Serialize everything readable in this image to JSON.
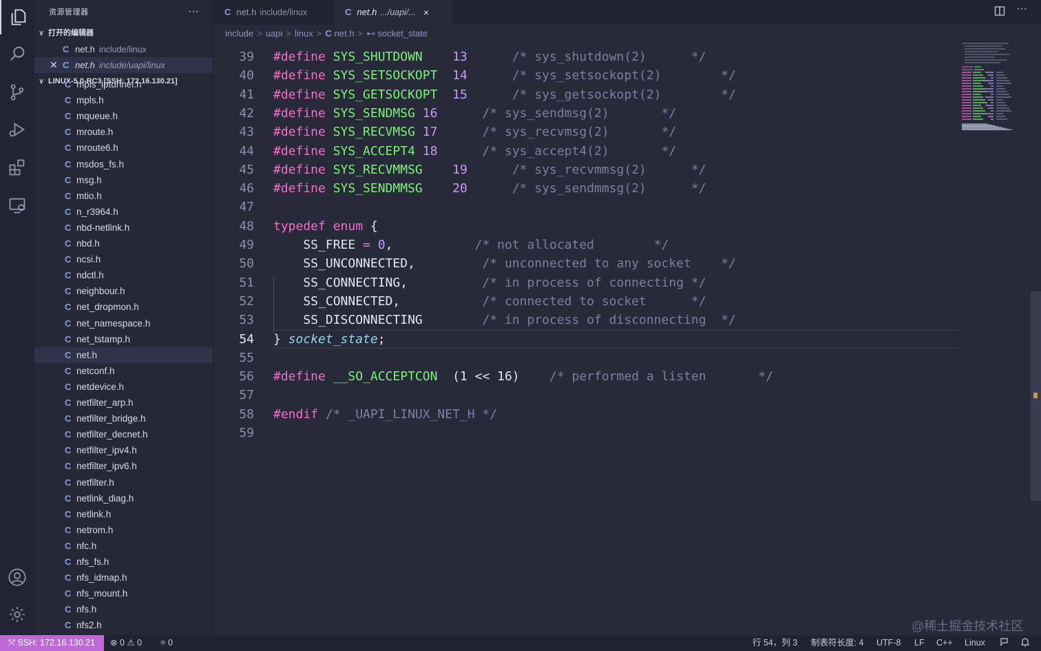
{
  "sidebar": {
    "title": "资源管理器",
    "more": "···",
    "open_editors_header": "打开的编辑器",
    "open_editors": [
      {
        "name": "net.h",
        "path": "include/linux",
        "selected": false
      },
      {
        "name": "net.h",
        "path": "include/uapi/linux",
        "selected": true
      }
    ],
    "workspace_header": "LINUX-5.0-RC3 [SSH: 172.16.130.21]",
    "files": [
      "mpls_iptunnel.h",
      "mpls.h",
      "mqueue.h",
      "mroute.h",
      "mroute6.h",
      "msdos_fs.h",
      "msg.h",
      "mtio.h",
      "n_r3964.h",
      "nbd-netlink.h",
      "nbd.h",
      "ncsi.h",
      "ndctl.h",
      "neighbour.h",
      "net_dropmon.h",
      "net_namespace.h",
      "net_tstamp.h",
      "net.h",
      "netconf.h",
      "netdevice.h",
      "netfilter_arp.h",
      "netfilter_bridge.h",
      "netfilter_decnet.h",
      "netfilter_ipv4.h",
      "netfilter_ipv6.h",
      "netfilter.h",
      "netlink_diag.h",
      "netlink.h",
      "netrom.h",
      "nfc.h",
      "nfs_fs.h",
      "nfs_idmap.h",
      "nfs_mount.h",
      "nfs.h",
      "nfs2.h"
    ],
    "selected_file": "net.h",
    "file_icon_letter": "C"
  },
  "tabs": [
    {
      "icon": "C",
      "name": "net.h",
      "path": "include/linux",
      "active": false
    },
    {
      "icon": "C",
      "name": "net.h",
      "path": ".../uapi/...",
      "active": true,
      "close": "×"
    }
  ],
  "breadcrumb": {
    "parts": [
      "include",
      "uapi",
      "linux",
      "net.h"
    ],
    "symbol": "socket_state",
    "sep": ">",
    "symbol_icon": "⊷"
  },
  "editor": {
    "current_line": 54,
    "lines": [
      {
        "n": "39",
        "tokens": [
          [
            "k",
            "#define "
          ],
          [
            "m",
            "SYS_SHUTDOWN"
          ],
          [
            "t",
            "    "
          ],
          [
            "n",
            "13"
          ],
          [
            "t",
            "      "
          ],
          [
            "cm",
            "/* sys_shutdown(2)      */"
          ]
        ]
      },
      {
        "n": "40",
        "tokens": [
          [
            "k",
            "#define "
          ],
          [
            "m",
            "SYS_SETSOCKOPT"
          ],
          [
            "t",
            "  "
          ],
          [
            "n",
            "14"
          ],
          [
            "t",
            "      "
          ],
          [
            "cm",
            "/* sys_setsockopt(2)        */"
          ]
        ]
      },
      {
        "n": "41",
        "tokens": [
          [
            "k",
            "#define "
          ],
          [
            "m",
            "SYS_GETSOCKOPT"
          ],
          [
            "t",
            "  "
          ],
          [
            "n",
            "15"
          ],
          [
            "t",
            "      "
          ],
          [
            "cm",
            "/* sys_getsockopt(2)        */"
          ]
        ]
      },
      {
        "n": "42",
        "tokens": [
          [
            "k",
            "#define "
          ],
          [
            "m",
            "SYS_SENDMSG"
          ],
          [
            "t",
            " "
          ],
          [
            "n",
            "16"
          ],
          [
            "t",
            "      "
          ],
          [
            "cm",
            "/* sys_sendmsg(2)       */"
          ]
        ]
      },
      {
        "n": "43",
        "tokens": [
          [
            "k",
            "#define "
          ],
          [
            "m",
            "SYS_RECVMSG"
          ],
          [
            "t",
            " "
          ],
          [
            "n",
            "17"
          ],
          [
            "t",
            "      "
          ],
          [
            "cm",
            "/* sys_recvmsg(2)       */"
          ]
        ]
      },
      {
        "n": "44",
        "tokens": [
          [
            "k",
            "#define "
          ],
          [
            "m",
            "SYS_ACCEPT4"
          ],
          [
            "t",
            " "
          ],
          [
            "n",
            "18"
          ],
          [
            "t",
            "      "
          ],
          [
            "cm",
            "/* sys_accept4(2)       */"
          ]
        ]
      },
      {
        "n": "45",
        "tokens": [
          [
            "k",
            "#define "
          ],
          [
            "m",
            "SYS_RECVMMSG"
          ],
          [
            "t",
            "    "
          ],
          [
            "n",
            "19"
          ],
          [
            "t",
            "      "
          ],
          [
            "cm",
            "/* sys_recvmmsg(2)      */"
          ]
        ]
      },
      {
        "n": "46",
        "tokens": [
          [
            "k",
            "#define "
          ],
          [
            "m",
            "SYS_SENDMMSG"
          ],
          [
            "t",
            "    "
          ],
          [
            "n",
            "20"
          ],
          [
            "t",
            "      "
          ],
          [
            "cm",
            "/* sys_sendmmsg(2)      */"
          ]
        ]
      },
      {
        "n": "47",
        "tokens": []
      },
      {
        "n": "48",
        "tokens": [
          [
            "k",
            "typedef "
          ],
          [
            "k",
            "enum "
          ],
          [
            "t",
            "{"
          ]
        ]
      },
      {
        "n": "49",
        "tokens": [
          [
            "t",
            "    SS_FREE "
          ],
          [
            "k",
            "= "
          ],
          [
            "n",
            "0"
          ],
          [
            "t",
            ",           "
          ],
          [
            "cm",
            "/* not allocated        */"
          ]
        ]
      },
      {
        "n": "50",
        "tokens": [
          [
            "t",
            "    SS_UNCONNECTED,         "
          ],
          [
            "cm",
            "/* unconnected to any socket    */"
          ]
        ]
      },
      {
        "n": "51",
        "tokens": [
          [
            "t",
            "    SS_CONNECTING,          "
          ],
          [
            "cm",
            "/* in process of connecting */"
          ]
        ]
      },
      {
        "n": "52",
        "tokens": [
          [
            "t",
            "    SS_CONNECTED,           "
          ],
          [
            "cm",
            "/* connected to socket      */"
          ]
        ]
      },
      {
        "n": "53",
        "tokens": [
          [
            "t",
            "    SS_DISCONNECTING        "
          ],
          [
            "cm",
            "/* in process of disconnecting  */"
          ]
        ]
      },
      {
        "n": "54",
        "tokens": [
          [
            "t",
            "} "
          ],
          [
            "ital",
            "socket_state"
          ],
          [
            "t",
            ";"
          ]
        ]
      },
      {
        "n": "55",
        "tokens": []
      },
      {
        "n": "56",
        "tokens": [
          [
            "k",
            "#define "
          ],
          [
            "m",
            "__SO_ACCEPTCON"
          ],
          [
            "t",
            "  (1 << 16)    "
          ],
          [
            "cm",
            "/* performed a listen       */"
          ]
        ]
      },
      {
        "n": "57",
        "tokens": []
      },
      {
        "n": "58",
        "tokens": [
          [
            "k",
            "#endif "
          ],
          [
            "cm",
            "/* _UAPI_LINUX_NET_H */"
          ]
        ]
      },
      {
        "n": "59",
        "tokens": []
      }
    ]
  },
  "watermark": "@稀土掘金技术社区",
  "status": {
    "remote": "SSH: 172.16.130.21",
    "errors": "0",
    "warnings": "0",
    "ports": "0",
    "position": "行 54，列 3",
    "tab_size": "制表符长度: 4",
    "encoding": "UTF-8",
    "eol": "LF",
    "language": "C++",
    "os": "Linux"
  },
  "colors": {
    "accent": "#c068d8",
    "macro": "#7cf27a",
    "keyword": "#f26ec8",
    "number": "#c69cf6",
    "comment": "#7c7fa0"
  }
}
